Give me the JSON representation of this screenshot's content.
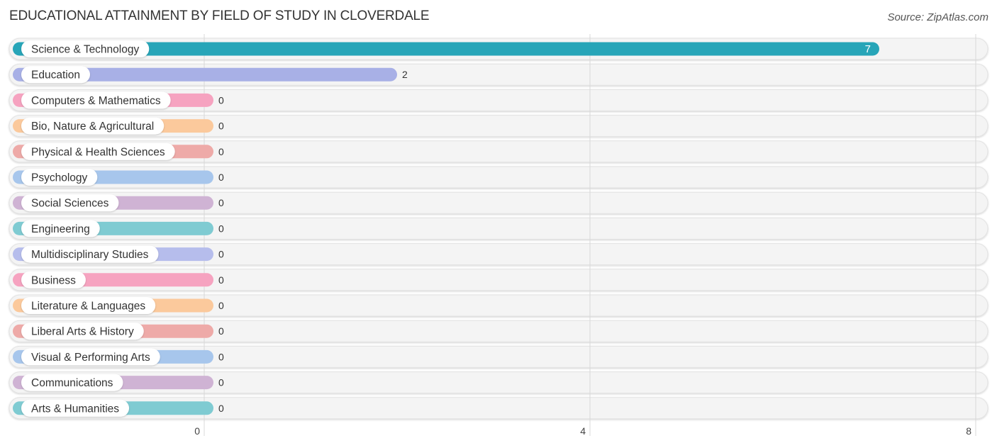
{
  "header": {
    "title": "EDUCATIONAL ATTAINMENT BY FIELD OF STUDY IN CLOVERDALE",
    "source": "Source: ZipAtlas.com"
  },
  "chart_data": {
    "type": "bar",
    "orientation": "horizontal",
    "title": "EDUCATIONAL ATTAINMENT BY FIELD OF STUDY IN CLOVERDALE",
    "xlabel": "",
    "ylabel": "",
    "xlim": [
      0,
      8
    ],
    "xticks": [
      0,
      4,
      8
    ],
    "grid": true,
    "legend": "none",
    "categories": [
      "Science & Technology",
      "Education",
      "Computers & Mathematics",
      "Bio, Nature & Agricultural",
      "Physical & Health Sciences",
      "Psychology",
      "Social Sciences",
      "Engineering",
      "Multidisciplinary Studies",
      "Business",
      "Literature & Languages",
      "Liberal Arts & History",
      "Visual & Performing Arts",
      "Communications",
      "Arts & Humanities"
    ],
    "values": [
      7,
      2,
      0,
      0,
      0,
      0,
      0,
      0,
      0,
      0,
      0,
      0,
      0,
      0,
      0
    ],
    "colors": [
      "#27a5b8",
      "#a8b0e6",
      "#f6a3c0",
      "#fbc99c",
      "#eeaaa8",
      "#a7c6ec",
      "#cfb3d4",
      "#7fcbd2",
      "#b6bdec",
      "#f6a3c0",
      "#fbc99c",
      "#eeaaa8",
      "#a7c6ec",
      "#cfb3d4",
      "#7fcbd2"
    ]
  }
}
